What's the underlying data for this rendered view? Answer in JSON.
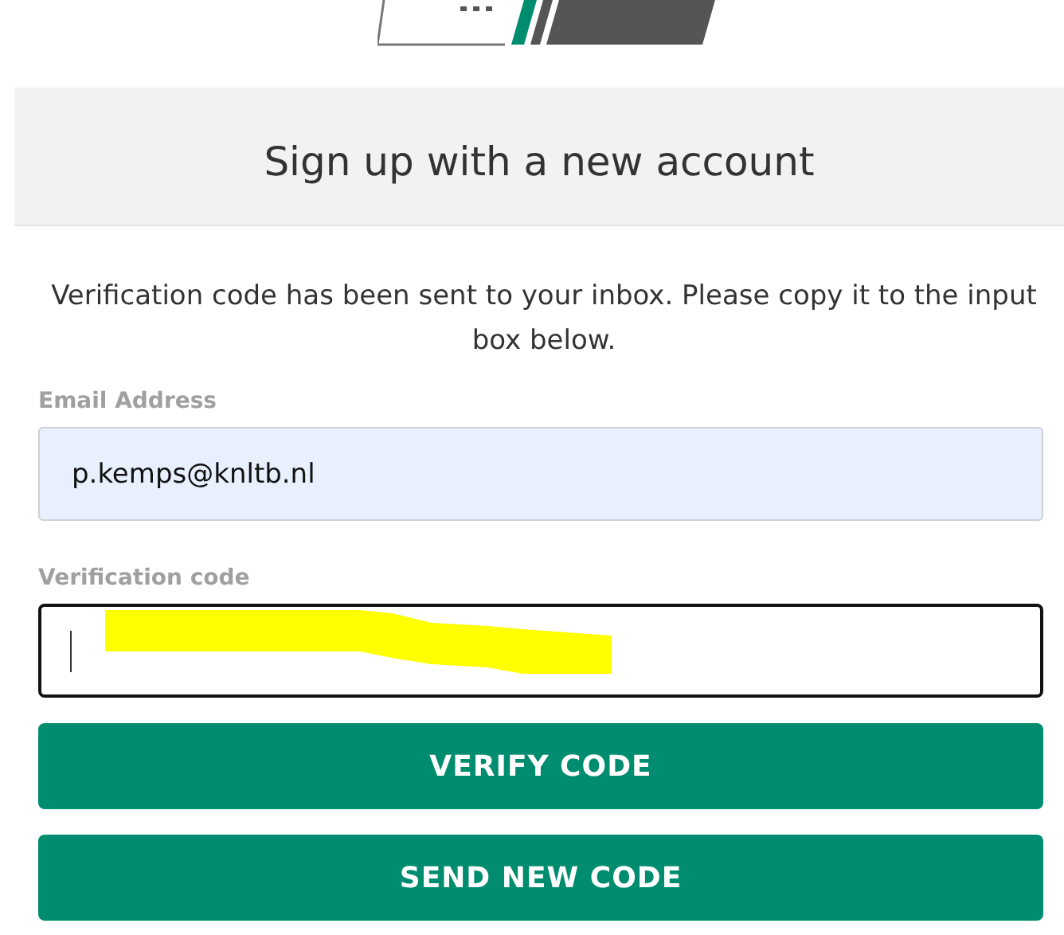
{
  "header": {
    "title": "Sign up with a new account"
  },
  "message": "Verification code has been sent to your inbox. Please copy it to the input box below.",
  "fields": [
    {
      "label": "Email Address",
      "value": "p.kemps@knltb.nl",
      "autofilled": true,
      "focused": false,
      "redacted": false
    },
    {
      "label": "Verification code",
      "autofilled": false,
      "focused": true,
      "redacted": true
    }
  ],
  "buttons": [
    "VERIFY CODE",
    "SEND NEW CODE"
  ]
}
